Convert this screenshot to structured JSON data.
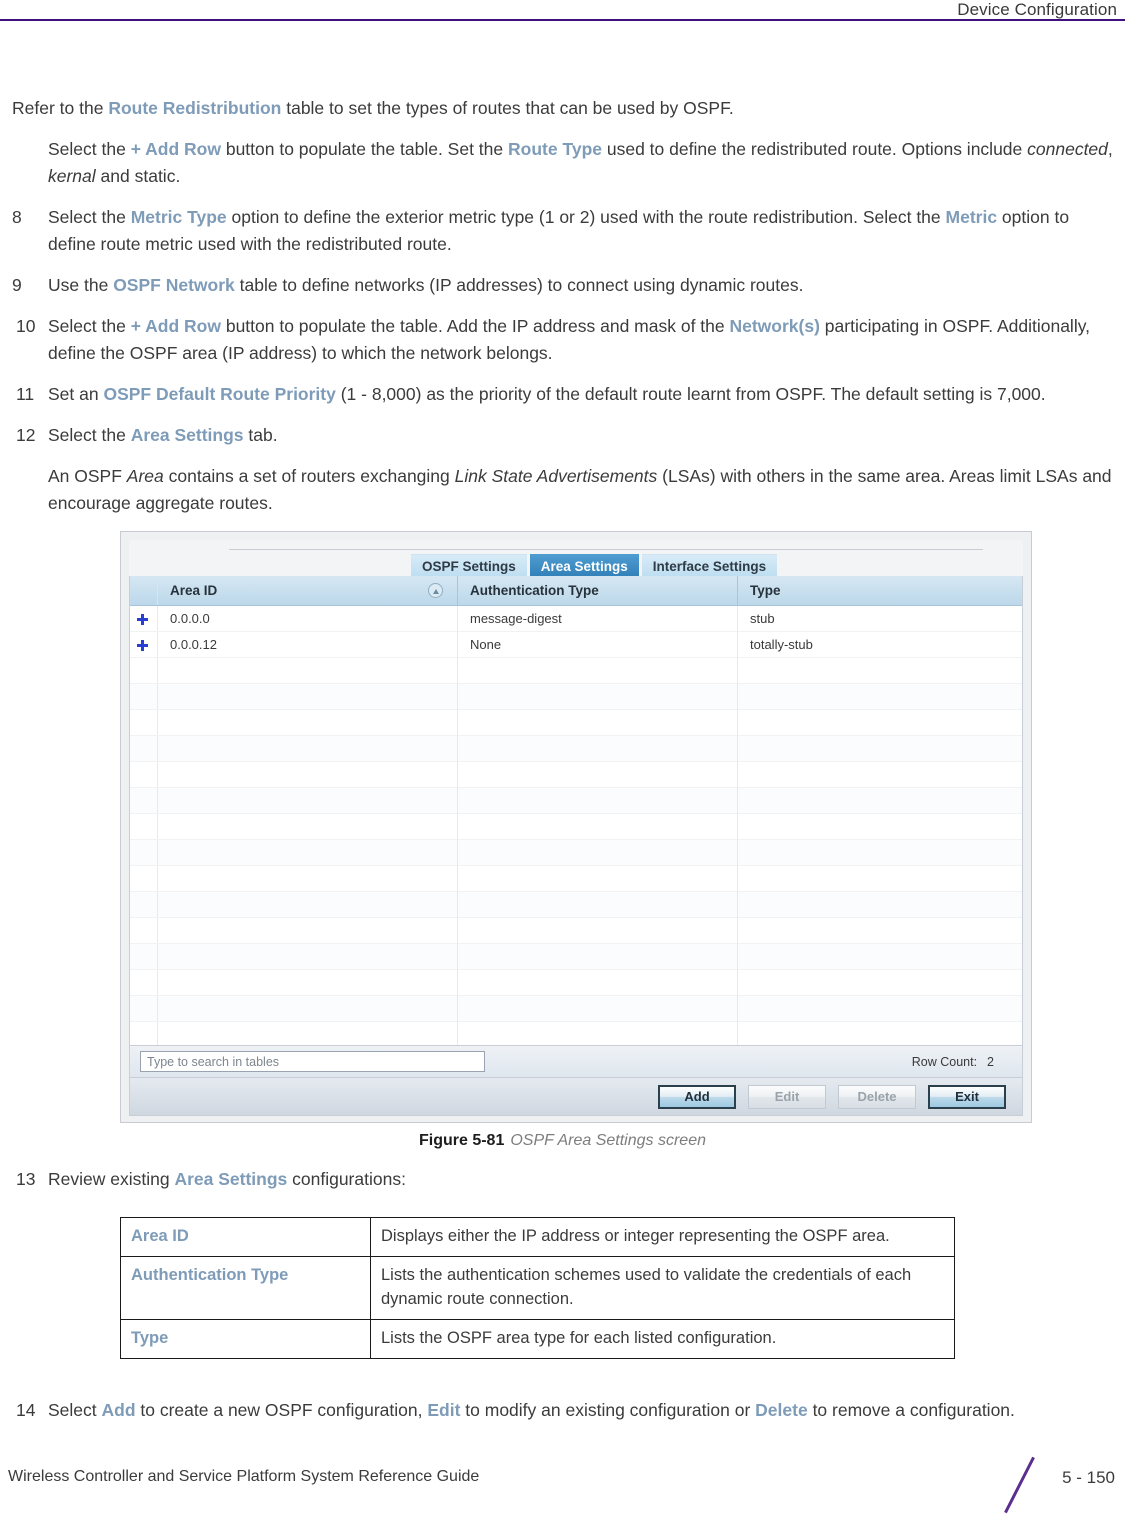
{
  "header": {
    "title": "Device Configuration"
  },
  "body": {
    "intro": {
      "pre": "Refer to the ",
      "term": "Route Redistribution",
      "post": " table to set the types of routes that can be used by OSPF."
    },
    "intro_sub": {
      "s1": "Select the ",
      "t1": "+ Add Row",
      "s2": " button to populate the table. Set the ",
      "t2": "Route Type",
      "s3": " used to define the redistributed route. Options include ",
      "i1": "connected",
      "s4": ", ",
      "i2": "kernal",
      "s5": " and static."
    },
    "step8": {
      "num": "8",
      "s1": "Select the ",
      "t1": "Metric Type",
      "s2": " option to define the exterior metric type (1 or 2) used with the route redistribution. Select the ",
      "t2": "Metric",
      "s3": " option to define route metric used with the redistributed route."
    },
    "step9": {
      "num": "9",
      "s1": "Use the ",
      "t1": "OSPF Network",
      "s2": " table to define networks (IP addresses) to connect using dynamic routes."
    },
    "step10": {
      "num": "10",
      "s1": "Select the ",
      "t1": "+ Add Row",
      "s2": " button to populate the table. Add the IP address and mask of the ",
      "t2": "Network(s)",
      "s3": " participating in OSPF. Additionally, define the OSPF area (IP address) to which the network belongs."
    },
    "step11": {
      "num": "11",
      "s1": "Set an ",
      "t1": "OSPF Default Route Priority",
      "s2": " (1 - 8,000) as the priority of the default route learnt from OSPF. The default setting is 7,000."
    },
    "step12": {
      "num": "12",
      "s1": "Select the ",
      "t1": "Area Settings",
      "s2": " tab."
    },
    "step12_sub": {
      "s1": "An OSPF ",
      "i1": "Area",
      "s2": " contains a set of routers exchanging ",
      "i2": "Link State Advertisements",
      "s3": " (LSAs) with others in the same area. Areas limit LSAs and encourage aggregate routes."
    },
    "step13": {
      "num": "13",
      "s1": "Review existing ",
      "t1": "Area Settings",
      "s2": " configurations:"
    },
    "step14": {
      "num": "14",
      "s1": "Select ",
      "t1": "Add",
      "s2": " to create a new OSPF configuration, ",
      "t2": "Edit",
      "s3": " to modify an existing configuration or ",
      "t3": "Delete",
      "s4": " to remove a configuration."
    }
  },
  "screenshot": {
    "tabs": [
      {
        "label": "OSPF Settings",
        "active": false
      },
      {
        "label": "Area Settings",
        "active": true
      },
      {
        "label": "Interface Settings",
        "active": false
      }
    ],
    "columns": [
      "Area ID",
      "Authentication Type",
      "Type"
    ],
    "sort_icon": "sort-ascending-icon",
    "rows": [
      {
        "area_id": "0.0.0.0",
        "auth_type": "message-digest",
        "type": "stub"
      },
      {
        "area_id": "0.0.0.12",
        "auth_type": "None",
        "type": "totally-stub"
      }
    ],
    "search": {
      "placeholder": "Type to search in tables",
      "value": ""
    },
    "row_count_label": "Row Count:",
    "row_count_value": "2",
    "buttons": [
      {
        "label": "Add",
        "state": "enabled"
      },
      {
        "label": "Edit",
        "state": "disabled"
      },
      {
        "label": "Delete",
        "state": "disabled"
      },
      {
        "label": "Exit",
        "state": "enabled"
      }
    ]
  },
  "figure": {
    "number": "Figure 5-81",
    "caption": "OSPF Area Settings screen"
  },
  "definition_table": {
    "rows": [
      {
        "term": "Area ID",
        "desc": "Displays either the IP address or integer representing the OSPF area."
      },
      {
        "term": "Authentication Type",
        "desc": "Lists the authentication schemes used to validate the credentials of each dynamic route connection."
      },
      {
        "term": "Type",
        "desc": "Lists the OSPF area type for each listed configuration."
      }
    ]
  },
  "footer": {
    "guide": "Wireless Controller and Service Platform System Reference Guide",
    "page": "5 - 150"
  },
  "colors": {
    "accent_blue": "#7e9bb8",
    "rule_purple": "#40107f",
    "slash_purple": "#5b2d8e",
    "tab_active": "#2d7cb5"
  }
}
